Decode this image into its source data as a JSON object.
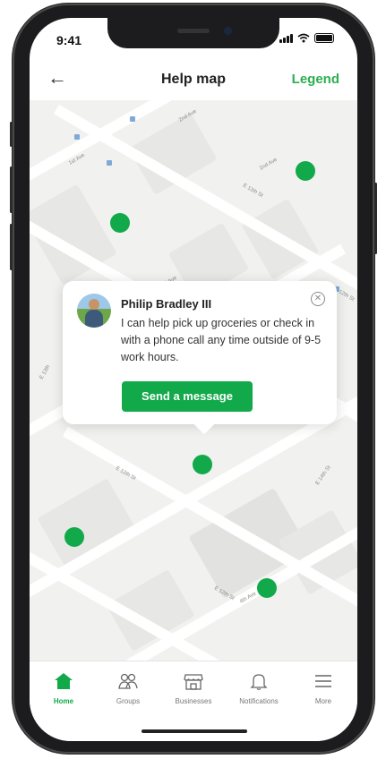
{
  "status_bar": {
    "time": "9:41"
  },
  "header": {
    "title": "Help map",
    "legend_label": "Legend",
    "back_icon": "back-arrow-icon"
  },
  "map": {
    "street_labels": [
      "1st Ave",
      "2nd Ave",
      "E 13th St",
      "2nd Ave",
      "E 12th St",
      "2nd Ave",
      "E 12th St",
      "E 14th St",
      "4th Ave",
      "E 12th St",
      "E 13th"
    ],
    "pin_color": "#12a94a"
  },
  "popup": {
    "name": "Philip Bradley III",
    "message": "I can help pick up groceries or check in with a phone call any time outside of 9-5 work hours.",
    "button_label": "Send a message",
    "close_icon": "close-icon",
    "button_color": "#12a94a"
  },
  "tabbar": {
    "items": [
      {
        "label": "Home",
        "icon": "home-icon",
        "active": true
      },
      {
        "label": "Groups",
        "icon": "groups-icon",
        "active": false
      },
      {
        "label": "Businesses",
        "icon": "store-icon",
        "active": false
      },
      {
        "label": "Notifications",
        "icon": "bell-icon",
        "active": false
      },
      {
        "label": "More",
        "icon": "menu-icon",
        "active": false
      }
    ],
    "active_color": "#12a94a"
  }
}
